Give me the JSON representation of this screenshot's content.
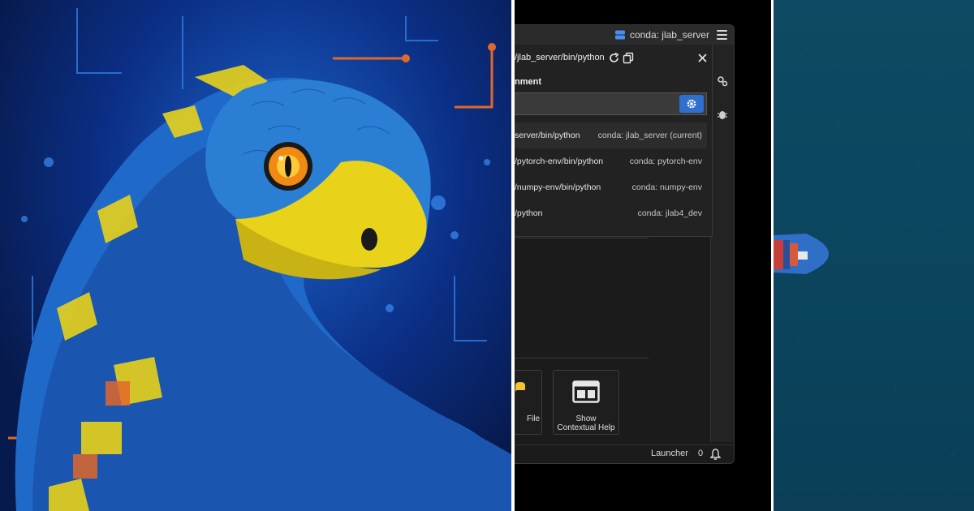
{
  "window": {
    "kernel_status": "conda: jlab_server",
    "interpreter_path": "/jlab_server/bin/python"
  },
  "picker": {
    "section_title": "nment",
    "search_placeholder": "",
    "environments": [
      {
        "path": "server/bin/python",
        "name": "conda: jlab_server (current)",
        "current": true
      },
      {
        "path": "/pytorch-env/bin/python",
        "name": "conda: pytorch-env",
        "current": false
      },
      {
        "path": "/numpy-env/bin/python",
        "name": "conda: numpy-env",
        "current": false
      },
      {
        "path": "/python",
        "name": "conda: jlab4_dev",
        "current": false
      }
    ]
  },
  "launcher": {
    "tile_file_label": "File",
    "tile_help_label_1": "Show",
    "tile_help_label_2": "Contextual Help"
  },
  "statusbar": {
    "tab_label": "Launcher",
    "notification_count": "0"
  },
  "icons": {
    "kernel": "database-icon",
    "menu": "hamburger-icon",
    "refresh": "refresh-icon",
    "copy": "copy-icon",
    "close": "close-icon",
    "settings": "gear-icon",
    "property_inspector": "gears-icon",
    "debugger": "bug-icon",
    "bell": "bell-icon"
  },
  "colors": {
    "accent": "#2f6fd0",
    "ui_background": "#1b1b1b",
    "snake_blue": "#2a7fd4",
    "snake_yellow": "#e8d21a",
    "ocean": "#0c4660"
  }
}
